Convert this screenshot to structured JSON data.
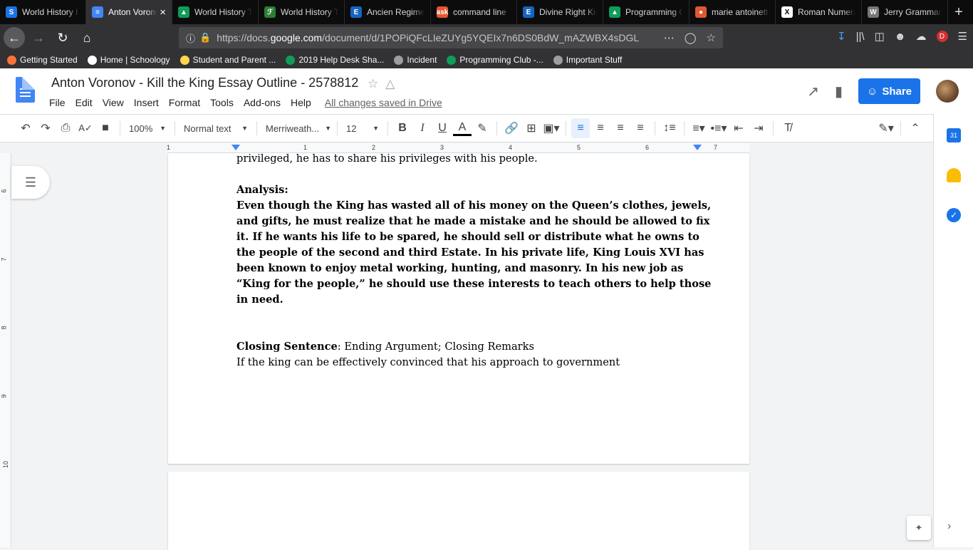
{
  "browser": {
    "tabs": [
      {
        "label": "World History I",
        "color": "#1a73e8",
        "glyph": "S"
      },
      {
        "label": "Anton Voronov",
        "color": "#4285f4",
        "glyph": "≡",
        "active": true
      },
      {
        "label": "World History T",
        "color": "#0f9d58",
        "glyph": "▲"
      },
      {
        "label": "World History T",
        "color": "#2e7d32",
        "glyph": "ℱ"
      },
      {
        "label": "Ancien Regime",
        "color": "#1565c0",
        "glyph": "E"
      },
      {
        "label": "command line",
        "color": "#e4572e",
        "glyph": "ask"
      },
      {
        "label": "Divine Right Kin",
        "color": "#1565c0",
        "glyph": "E"
      },
      {
        "label": "Programming C",
        "color": "#0f9d58",
        "glyph": "▲"
      },
      {
        "label": "marie antoinett",
        "color": "#de5833",
        "glyph": "●"
      },
      {
        "label": "Roman Numera",
        "color": "#ffffff",
        "glyph": "X"
      },
      {
        "label": "Jerry Grammar",
        "color": "#777777",
        "glyph": "W"
      }
    ],
    "new_tab": "+",
    "url_prefix": "https://docs.",
    "url_domain": "google.com",
    "url_rest": "/document/d/1POPiQFcLIeZUYg5YQEIx7n6DS0BdW_mAZWBX4sDGL",
    "bookmarks": [
      {
        "label": "Getting Started",
        "color": "#ff7139"
      },
      {
        "label": "Home | Schoology",
        "color": "#ffffff"
      },
      {
        "label": "Student and Parent ...",
        "color": "#ffd54f"
      },
      {
        "label": "2019 Help Desk Sha...",
        "color": "#0f9d58"
      },
      {
        "label": "Incident",
        "color": "#9e9e9e"
      },
      {
        "label": "Programming Club -...",
        "color": "#0f9d58"
      },
      {
        "label": "Important Stuff",
        "color": "#9e9e9e"
      }
    ]
  },
  "doc": {
    "title": "Anton Voronov - Kill the King Essay Outline - 2578812",
    "menu": [
      "File",
      "Edit",
      "View",
      "Insert",
      "Format",
      "Tools",
      "Add-ons",
      "Help"
    ],
    "save_status": "All changes saved in Drive",
    "share_label": "Share"
  },
  "toolbar": {
    "zoom": "100%",
    "style": "Normal text",
    "font": "Merriweath...",
    "size": "12"
  },
  "ruler": {
    "h_numbers": [
      "1",
      "1",
      "2",
      "3",
      "4",
      "5",
      "6",
      "7"
    ],
    "v_numbers": [
      "6",
      "7",
      "8",
      "9",
      "10"
    ]
  },
  "content": {
    "line0": "privileged, he has to share his privileges with his people.",
    "analysis_heading": "Analysis:",
    "analysis_lines": [
      "Even though the King has wasted all of his money on the Queen’s clothes, jewels,",
      "and gifts, he must realize that he made a mistake and he should be allowed to fix",
      "it. If he wants his life to be spared, he should sell or distribute what he owns to",
      "the people of the second and third Estate. In his private life, King Louis XVI has",
      "been known to enjoy metal working, hunting, and masonry. In his new job as",
      "“King for the people,” he should use these interests to teach others to help those",
      "in need."
    ],
    "closing_label": "Closing Sentence",
    "closing_rest": ": Ending Argument; Closing Remarks",
    "closing_line": "If the king can be effectively convinced that his approach to government"
  }
}
